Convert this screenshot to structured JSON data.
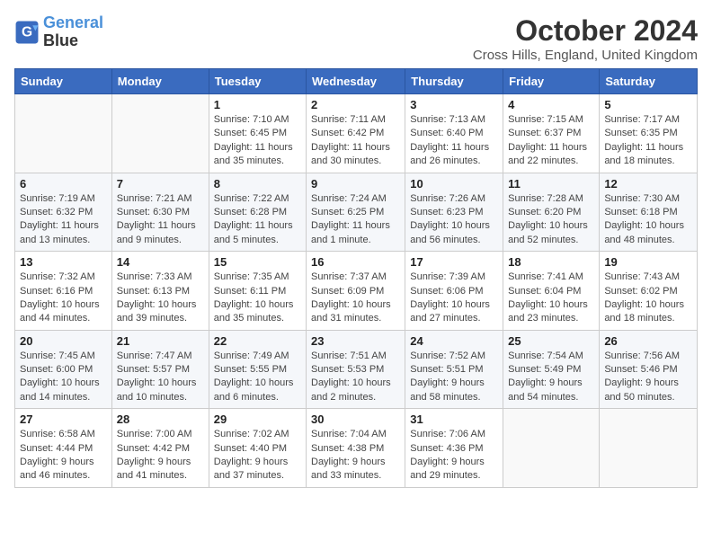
{
  "logo": {
    "line1": "General",
    "line2": "Blue"
  },
  "title": "October 2024",
  "location": "Cross Hills, England, United Kingdom",
  "days_of_week": [
    "Sunday",
    "Monday",
    "Tuesday",
    "Wednesday",
    "Thursday",
    "Friday",
    "Saturday"
  ],
  "weeks": [
    [
      {
        "day": "",
        "info": ""
      },
      {
        "day": "",
        "info": ""
      },
      {
        "day": "1",
        "info": "Sunrise: 7:10 AM\nSunset: 6:45 PM\nDaylight: 11 hours and 35 minutes."
      },
      {
        "day": "2",
        "info": "Sunrise: 7:11 AM\nSunset: 6:42 PM\nDaylight: 11 hours and 30 minutes."
      },
      {
        "day": "3",
        "info": "Sunrise: 7:13 AM\nSunset: 6:40 PM\nDaylight: 11 hours and 26 minutes."
      },
      {
        "day": "4",
        "info": "Sunrise: 7:15 AM\nSunset: 6:37 PM\nDaylight: 11 hours and 22 minutes."
      },
      {
        "day": "5",
        "info": "Sunrise: 7:17 AM\nSunset: 6:35 PM\nDaylight: 11 hours and 18 minutes."
      }
    ],
    [
      {
        "day": "6",
        "info": "Sunrise: 7:19 AM\nSunset: 6:32 PM\nDaylight: 11 hours and 13 minutes."
      },
      {
        "day": "7",
        "info": "Sunrise: 7:21 AM\nSunset: 6:30 PM\nDaylight: 11 hours and 9 minutes."
      },
      {
        "day": "8",
        "info": "Sunrise: 7:22 AM\nSunset: 6:28 PM\nDaylight: 11 hours and 5 minutes."
      },
      {
        "day": "9",
        "info": "Sunrise: 7:24 AM\nSunset: 6:25 PM\nDaylight: 11 hours and 1 minute."
      },
      {
        "day": "10",
        "info": "Sunrise: 7:26 AM\nSunset: 6:23 PM\nDaylight: 10 hours and 56 minutes."
      },
      {
        "day": "11",
        "info": "Sunrise: 7:28 AM\nSunset: 6:20 PM\nDaylight: 10 hours and 52 minutes."
      },
      {
        "day": "12",
        "info": "Sunrise: 7:30 AM\nSunset: 6:18 PM\nDaylight: 10 hours and 48 minutes."
      }
    ],
    [
      {
        "day": "13",
        "info": "Sunrise: 7:32 AM\nSunset: 6:16 PM\nDaylight: 10 hours and 44 minutes."
      },
      {
        "day": "14",
        "info": "Sunrise: 7:33 AM\nSunset: 6:13 PM\nDaylight: 10 hours and 39 minutes."
      },
      {
        "day": "15",
        "info": "Sunrise: 7:35 AM\nSunset: 6:11 PM\nDaylight: 10 hours and 35 minutes."
      },
      {
        "day": "16",
        "info": "Sunrise: 7:37 AM\nSunset: 6:09 PM\nDaylight: 10 hours and 31 minutes."
      },
      {
        "day": "17",
        "info": "Sunrise: 7:39 AM\nSunset: 6:06 PM\nDaylight: 10 hours and 27 minutes."
      },
      {
        "day": "18",
        "info": "Sunrise: 7:41 AM\nSunset: 6:04 PM\nDaylight: 10 hours and 23 minutes."
      },
      {
        "day": "19",
        "info": "Sunrise: 7:43 AM\nSunset: 6:02 PM\nDaylight: 10 hours and 18 minutes."
      }
    ],
    [
      {
        "day": "20",
        "info": "Sunrise: 7:45 AM\nSunset: 6:00 PM\nDaylight: 10 hours and 14 minutes."
      },
      {
        "day": "21",
        "info": "Sunrise: 7:47 AM\nSunset: 5:57 PM\nDaylight: 10 hours and 10 minutes."
      },
      {
        "day": "22",
        "info": "Sunrise: 7:49 AM\nSunset: 5:55 PM\nDaylight: 10 hours and 6 minutes."
      },
      {
        "day": "23",
        "info": "Sunrise: 7:51 AM\nSunset: 5:53 PM\nDaylight: 10 hours and 2 minutes."
      },
      {
        "day": "24",
        "info": "Sunrise: 7:52 AM\nSunset: 5:51 PM\nDaylight: 9 hours and 58 minutes."
      },
      {
        "day": "25",
        "info": "Sunrise: 7:54 AM\nSunset: 5:49 PM\nDaylight: 9 hours and 54 minutes."
      },
      {
        "day": "26",
        "info": "Sunrise: 7:56 AM\nSunset: 5:46 PM\nDaylight: 9 hours and 50 minutes."
      }
    ],
    [
      {
        "day": "27",
        "info": "Sunrise: 6:58 AM\nSunset: 4:44 PM\nDaylight: 9 hours and 46 minutes."
      },
      {
        "day": "28",
        "info": "Sunrise: 7:00 AM\nSunset: 4:42 PM\nDaylight: 9 hours and 41 minutes."
      },
      {
        "day": "29",
        "info": "Sunrise: 7:02 AM\nSunset: 4:40 PM\nDaylight: 9 hours and 37 minutes."
      },
      {
        "day": "30",
        "info": "Sunrise: 7:04 AM\nSunset: 4:38 PM\nDaylight: 9 hours and 33 minutes."
      },
      {
        "day": "31",
        "info": "Sunrise: 7:06 AM\nSunset: 4:36 PM\nDaylight: 9 hours and 29 minutes."
      },
      {
        "day": "",
        "info": ""
      },
      {
        "day": "",
        "info": ""
      }
    ]
  ]
}
